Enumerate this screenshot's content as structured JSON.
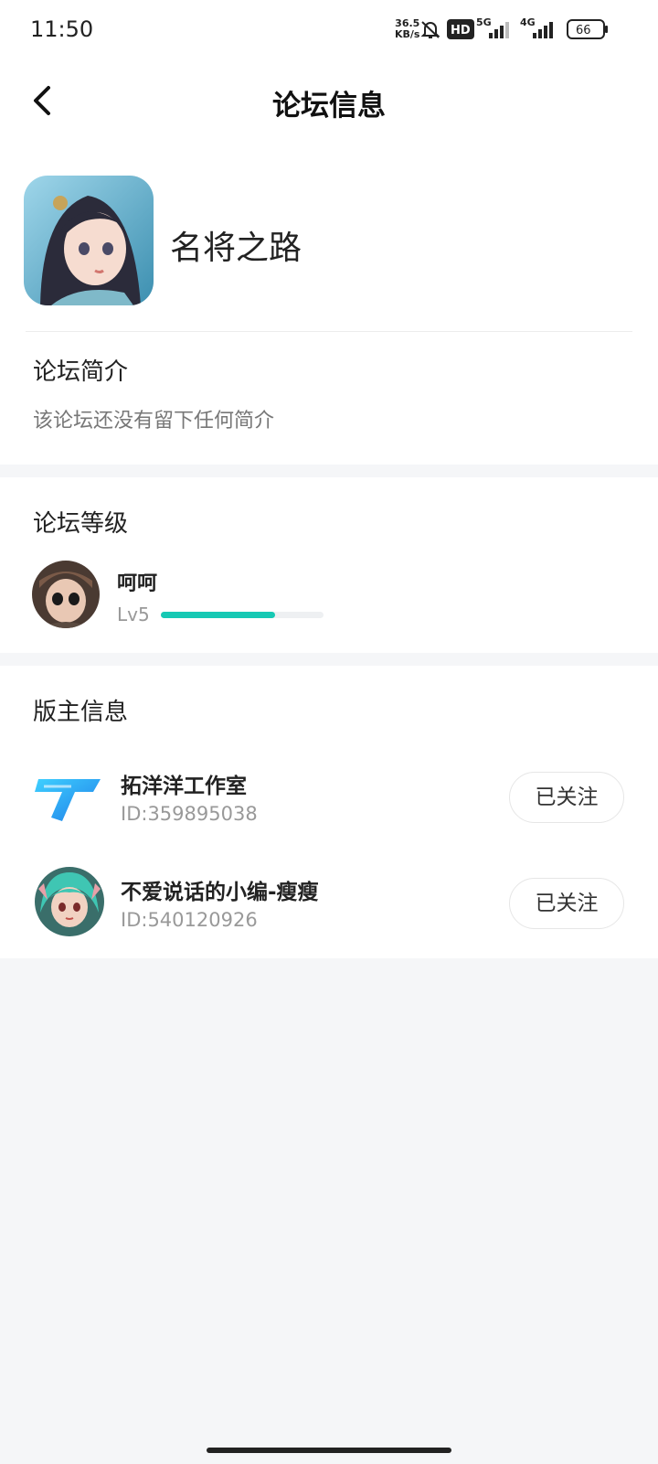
{
  "status_bar": {
    "time": "11:50",
    "net_speed_value": "36.5",
    "net_speed_unit": "KB/s",
    "hd_label": "HD",
    "net_5g": "5G",
    "net_4g": "4G",
    "battery": "66"
  },
  "nav": {
    "title": "论坛信息"
  },
  "forum": {
    "name": "名将之路",
    "intro_title": "论坛简介",
    "intro_text": "该论坛还没有留下任何简介"
  },
  "level": {
    "title": "论坛等级",
    "user_name": "呵呵",
    "user_level": "Lv5",
    "progress": 0.7
  },
  "moderators": {
    "title": "版主信息",
    "items": [
      {
        "name": "拓洋洋工作室",
        "id": "ID:359895038",
        "follow_label": "已关注"
      },
      {
        "name": "不爱说话的小编-瘦瘦",
        "id": "ID:540120926",
        "follow_label": "已关注"
      }
    ]
  },
  "colors": {
    "accent": "#16c9b4",
    "background": "#f5f6f8"
  }
}
